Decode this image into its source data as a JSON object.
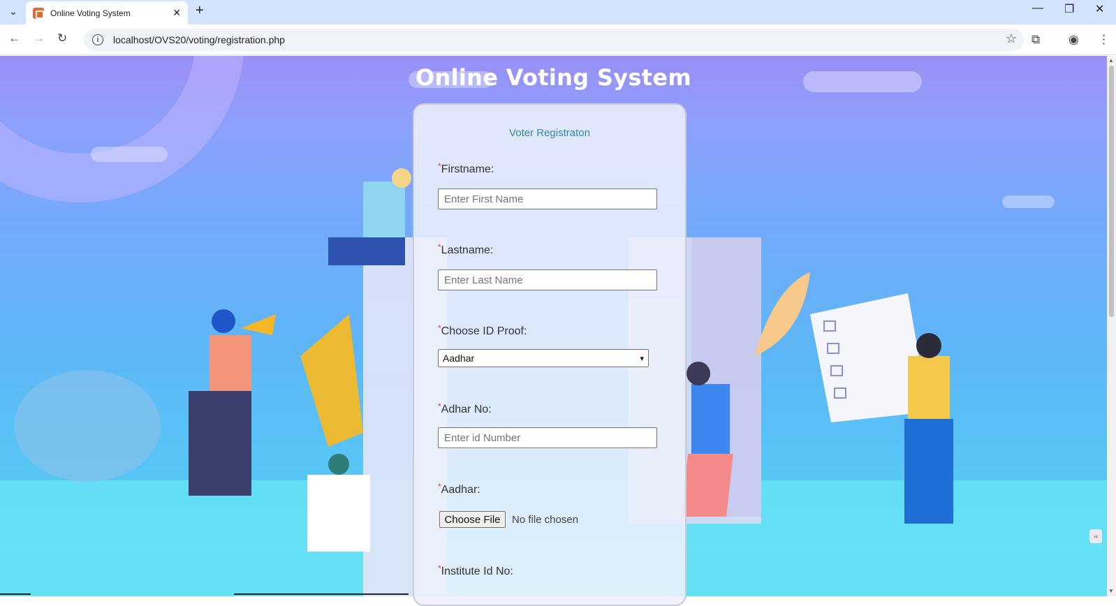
{
  "browser": {
    "tab_title": "Online Voting System",
    "tab_close": "✕",
    "new_tab": "+",
    "url": "localhost/OVS20/voting/registration.php",
    "minimize": "—",
    "restore": "❐",
    "close": "✕"
  },
  "page": {
    "title": "Online Voting System",
    "form_title": "Voter Registraton",
    "required_mark": "*",
    "fields": {
      "firstname_label": "Firstname:",
      "firstname_placeholder": "Enter First Name",
      "lastname_label": "Lastname:",
      "lastname_placeholder": "Enter Last Name",
      "idproof_label": "Choose ID Proof:",
      "idproof_selected": "Aadhar",
      "adhar_no_label": "Adhar No:",
      "adhar_no_placeholder": "Enter id Number",
      "aadhar_label": "Aadhar:",
      "choose_file": "Choose File",
      "file_status": "No file chosen",
      "institute_label": "Institute Id No:"
    }
  },
  "icons": {
    "tab_menu": "chevron-down-icon",
    "back": "back-arrow-icon",
    "forward": "forward-arrow-icon",
    "reload": "reload-icon",
    "info": "info-icon",
    "star": "star-icon",
    "extensions": "extensions-icon",
    "profile": "profile-icon",
    "menu": "more-vert-icon"
  }
}
